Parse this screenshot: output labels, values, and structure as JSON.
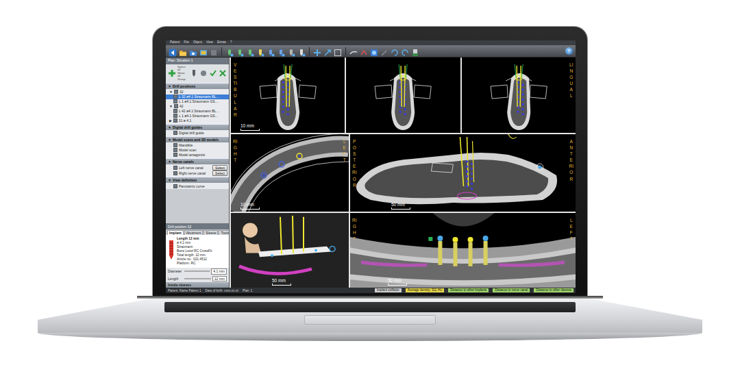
{
  "menu": [
    "Patient",
    "File",
    "Object",
    "View",
    "Extras",
    "?"
  ],
  "toolbar": {
    "help": "?"
  },
  "sidebar": {
    "plan": "Plan: Situation 1",
    "tool_caption": [
      "Select all",
      "Show all",
      "Group"
    ],
    "sections": [
      {
        "toggle": "▼",
        "title": "Drill positions",
        "expanded": true,
        "items": [
          {
            "kind": "group",
            "toggle": "▼",
            "label": "32",
            "checked": true,
            "selected": false
          },
          {
            "kind": "item",
            "label": "L 32 ø4.1 Straumann BL…",
            "checked": true,
            "selected": true
          },
          {
            "kind": "item",
            "label": "L 1 ø4.1 Straumann GS…",
            "checked": true,
            "selected": false
          },
          {
            "kind": "group",
            "toggle": "▼",
            "label": "42",
            "checked": true,
            "selected": false
          },
          {
            "kind": "item",
            "label": "L 42 ø4.1 Straumann BL…",
            "checked": true,
            "selected": false
          },
          {
            "kind": "item",
            "label": "L 1 ø4.1 Straumann GS…",
            "checked": true,
            "selected": false
          },
          {
            "kind": "group",
            "toggle": "▶",
            "label": "31 ø 4.1",
            "checked": true,
            "selected": false
          }
        ]
      },
      {
        "toggle": "▼",
        "title": "Digital drill guides",
        "expanded": true,
        "items": [
          {
            "kind": "item",
            "label": "Digital drill guide",
            "checked": true,
            "selected": false
          }
        ]
      },
      {
        "toggle": "▼",
        "title": "Model scans and 3D models",
        "expanded": true,
        "items": [
          {
            "kind": "item",
            "label": "Mandible",
            "checked": true,
            "selected": false
          },
          {
            "kind": "item",
            "label": "Model scan",
            "checked": true,
            "selected": false
          },
          {
            "kind": "item",
            "label": "Model antagonist",
            "checked": true,
            "selected": false
          }
        ]
      },
      {
        "toggle": "▼",
        "title": "Nerve canals",
        "expanded": true,
        "items": [
          {
            "kind": "button",
            "label": "Left nerve canal",
            "button": "Select",
            "checked": true,
            "selected": false
          },
          {
            "kind": "button",
            "label": "Right nerve canal",
            "button": "Select",
            "checked": true,
            "selected": false
          }
        ]
      },
      {
        "toggle": "▼",
        "title": "View definition",
        "expanded": true,
        "items": [
          {
            "kind": "item",
            "label": "Panoramic curve",
            "checked": true,
            "selected": false
          }
        ]
      }
    ]
  },
  "implant_panel": {
    "title": "Drill position 32",
    "tabs": [
      {
        "label": "Implant",
        "selected": true
      },
      {
        "label": "Abutment",
        "selected": false
      },
      {
        "label": "Sleeve",
        "selected": false
      },
      {
        "label": "Tools",
        "selected": false
      }
    ],
    "info": [
      "Length 12 mm",
      "ø 4.1 mm",
      "Straumann",
      "Bone Level RC CrossFit",
      "Total length: 12 mm",
      "Article no.: 021.4512",
      "Platform: RC"
    ],
    "params": [
      {
        "label": "Diameter",
        "value": "4.1 mm"
      },
      {
        "label": "Length",
        "value": "12 mm"
      }
    ],
    "footer": "Inside sleeves"
  },
  "viewports": [
    {
      "kind": "cross",
      "left_label": "VESTIBULAR",
      "scale": "10 mm"
    },
    {
      "kind": "cross"
    },
    {
      "kind": "cross",
      "right_label": "LINGUAL"
    },
    {
      "kind": "axial",
      "left_label": "RIGHT",
      "right_label": "LEFT",
      "scale": "10 mm"
    },
    {
      "kind": "sagittal",
      "left_label": "POSTERIOR",
      "right_label": "ANTERIOR",
      "scale": "50 mm"
    },
    {
      "kind": "3d",
      "scale": "50 mm"
    },
    {
      "kind": "panoramic",
      "left_label": "RIGHT",
      "right_label": "LEFT",
      "scale": "50 mm"
    }
  ],
  "status_bar": {
    "left": [
      "Patient: Name Patient 1",
      "Date of birth: xxxx.xx.xx",
      "Plan: 1"
    ],
    "indicators": [
      {
        "label": "Implant collision",
        "color": "#cfcfcf"
      },
      {
        "label": "Average density: 311 HU",
        "color": "#e8d84a"
      },
      {
        "label": "Distance to other implants",
        "color": "#9fd46a"
      },
      {
        "label": "Distance to nerve canal",
        "color": "#9fd46a"
      },
      {
        "label": "Distance to other sleeves",
        "color": "#9fd46a"
      }
    ]
  }
}
